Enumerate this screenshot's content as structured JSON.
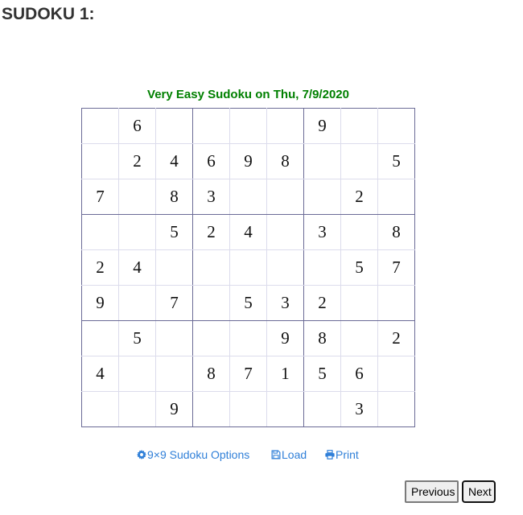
{
  "page": {
    "title": "SUDOKU 1:"
  },
  "puzzle": {
    "caption": "Very Easy Sudoku on Thu, 7/9/2020",
    "difficulty": "Very Easy",
    "date": "Thu, 7/9/2020",
    "caption_color": "#008000",
    "grid": [
      [
        "",
        "6",
        "",
        "",
        "",
        "",
        "9",
        "",
        ""
      ],
      [
        "",
        "2",
        "4",
        "6",
        "9",
        "8",
        "",
        "",
        "5"
      ],
      [
        "7",
        "",
        "8",
        "3",
        "",
        "",
        "",
        "2",
        ""
      ],
      [
        "",
        "",
        "5",
        "2",
        "4",
        "",
        "3",
        "",
        "8"
      ],
      [
        "2",
        "4",
        "",
        "",
        "",
        "",
        "",
        "5",
        "7"
      ],
      [
        "9",
        "",
        "7",
        "",
        "5",
        "3",
        "2",
        "",
        ""
      ],
      [
        "",
        "5",
        "",
        "",
        "",
        "9",
        "8",
        "",
        "2"
      ],
      [
        "4",
        "",
        "",
        "8",
        "7",
        "1",
        "5",
        "6",
        ""
      ],
      [
        "",
        "",
        "9",
        "",
        "",
        "",
        "",
        "3",
        ""
      ]
    ]
  },
  "links": {
    "options": {
      "label": "9×9 Sudoku Options",
      "icon": "gear-icon"
    },
    "load": {
      "label": "Load",
      "icon": "save-icon"
    },
    "print": {
      "label": "Print",
      "icon": "print-icon"
    },
    "color": "#2f7fd8"
  },
  "nav": {
    "previous_label": "Previous",
    "next_label": "Next"
  }
}
